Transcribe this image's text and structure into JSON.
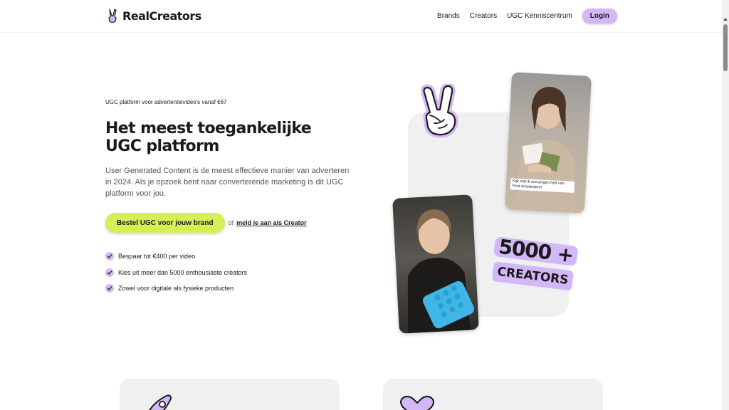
{
  "header": {
    "brand": "RealCreators",
    "nav": [
      "Brands",
      "Creators",
      "UGC Kenniscentrum"
    ],
    "login_label": "Login"
  },
  "hero": {
    "eyebrow": "UGC platform voor advertentievideo's vanaf €67",
    "headline": "Het meest toegankelijke UGC platform",
    "intro": "User Generated Content is de meest effectieve manier van adverteren in 2024. Als je opzoek bent naar converterende marketing is dit UGC platform voor jou.",
    "cta_label": "Bestel UGC voor jouw brand",
    "or_text": "of",
    "creator_link": "meld je aan als Creator",
    "benefits": [
      "Bespaar tot €400 per video",
      "Kies uit meer dan 5000 enthousiaste creators",
      "Zowel voor digitale als fysieke producten"
    ]
  },
  "visuals": {
    "video_caption": "Kijk wat ik ontvangen heb van First Amsterdam!",
    "badge_number": "5000 +",
    "badge_word": "CREATORS"
  },
  "colors": {
    "accent_purple": "#d4b7f7",
    "cta_lime": "#d7ef57",
    "panel_gray": "#f0f0f0"
  },
  "icons": [
    "peace-hand-icon",
    "check-icon",
    "rocket-icon",
    "heart-icon"
  ]
}
